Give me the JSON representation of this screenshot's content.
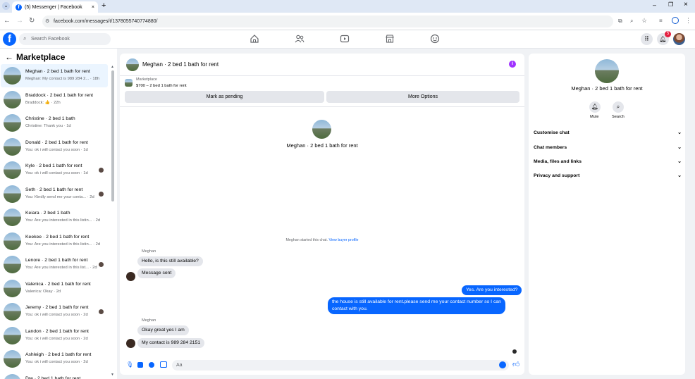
{
  "browser": {
    "tab_title": "(5) Messenger | Facebook",
    "new_tab": "+",
    "url": "facebook.com/messages/t/1378055740774880/"
  },
  "fb": {
    "search_placeholder": "Search Facebook",
    "notification_count": "5"
  },
  "sidebar": {
    "title": "Marketplace",
    "conversations": [
      {
        "title": "Meghan · 2 bed 1 bath for rent",
        "subtitle": "Meghan: My contact is 989 284 2... · 18h",
        "active": true,
        "read_avatar": false
      },
      {
        "title": "Braddock · 2 bed 1 bath for rent",
        "subtitle": "Braddock: 👍 · 22h",
        "active": false,
        "read_avatar": false
      },
      {
        "title": "Christine · 2 bed 1 bath",
        "subtitle": "Christine: Thank you · 1d",
        "active": false,
        "read_avatar": false
      },
      {
        "title": "Donald · 2 bed 1 bath for rent",
        "subtitle": "You: ok i will contact you soon · 1d",
        "active": false,
        "read_avatar": false
      },
      {
        "title": "Kyle · 2 bed 1 bath for rent",
        "subtitle": "You: ok i will contact you soon · 1d",
        "active": false,
        "read_avatar": true
      },
      {
        "title": "Seth · 2 bed 1 bath for rent",
        "subtitle": "You: Kindly send me your conta... · 2d",
        "active": false,
        "read_avatar": true
      },
      {
        "title": "Keiara · 2 bed 1 bath",
        "subtitle": "You: Are you interested in this listin... · 2d",
        "active": false,
        "read_avatar": false
      },
      {
        "title": "Keekee · 2 bed 1 bath for rent",
        "subtitle": "You: Are you interested in this listin... · 2d",
        "active": false,
        "read_avatar": false
      },
      {
        "title": "Lenore · 2 bed 1 bath for rent",
        "subtitle": "You: Are you interested in this list... · 2d",
        "active": false,
        "read_avatar": true
      },
      {
        "title": "Valenica · 2 bed 1 bath for rent",
        "subtitle": "Valenica: Okay · 2d",
        "active": false,
        "read_avatar": false
      },
      {
        "title": "Jeremy · 2 bed 1 bath for rent",
        "subtitle": "You: ok i will contact you soon · 2d",
        "active": false,
        "read_avatar": true
      },
      {
        "title": "Landon · 2 bed 1 bath for rent",
        "subtitle": "You: ok i will contact you soon · 2d",
        "active": false,
        "read_avatar": false
      },
      {
        "title": "Ashleigh · 2 bed 1 bath for rent",
        "subtitle": "You: ok i will contact you soon · 2d",
        "active": false,
        "read_avatar": false
      },
      {
        "title": "Dre · 2 bed 1 bath for rent",
        "subtitle": "",
        "active": false,
        "read_avatar": false
      }
    ]
  },
  "chat": {
    "header_title": "Meghan · 2 bed 1 bath for rent",
    "listing_label": "Marketplace",
    "listing_price": "$700 – 2 bed 1 bath for rent",
    "mark_pending": "Mark as pending",
    "more_options": "More Options",
    "center_title": "Meghan · 2 bed 1 bath for rent",
    "started_text": "Meghan started this chat.",
    "view_profile": "View buyer profile",
    "sender_name_1": "Meghan",
    "msg_1": "Hello, is this still available?",
    "msg_2": "Message sent",
    "msg_me_1": "Yes. Are you interested?",
    "msg_me_2a": "the house is still available for rent.please send me your contact number so I can",
    "msg_me_2b": "contact with you.",
    "sender_name_2": "Meghan",
    "msg_3": "Okay great yes I am",
    "msg_4": "My contact is 989 284 2151",
    "composer_placeholder": "Aa"
  },
  "info": {
    "title": "Meghan · 2 bed 1 bath for rent",
    "mute": "Mute",
    "search": "Search",
    "rows": [
      "Customise chat",
      "Chat members",
      "Media, files and links",
      "Privacy and support"
    ]
  }
}
